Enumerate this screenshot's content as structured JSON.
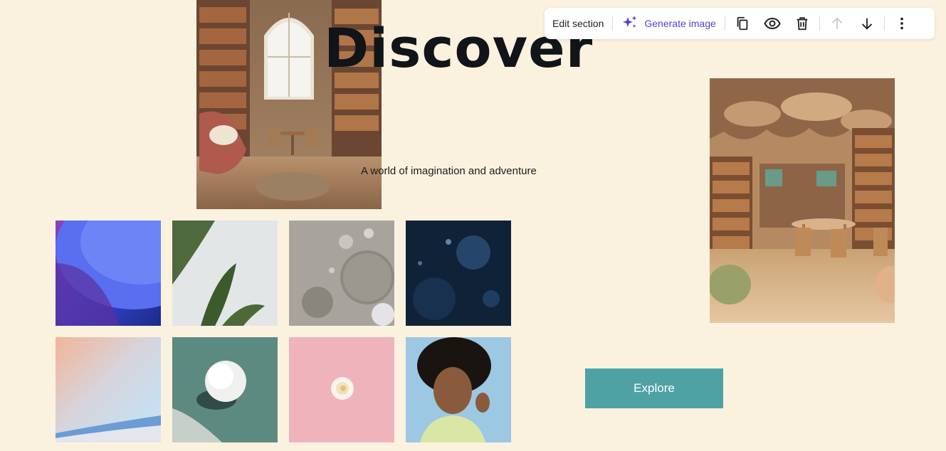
{
  "toolbar": {
    "edit_section_label": "Edit section",
    "generate_image_label": "Generate image",
    "accent_color": "#5b3ec9",
    "icons": [
      "sparkle-icon",
      "copy-icon",
      "eye-icon",
      "trash-icon",
      "arrow-up-icon",
      "arrow-down-icon",
      "more-vertical-icon"
    ]
  },
  "hero": {
    "title": "Discover",
    "subtitle": "A world of imagination and adventure",
    "button_label": "Explore",
    "button_color": "#4fa2a3",
    "background_color": "#faf2df"
  },
  "images": {
    "left_feature": "cozy-reading-room",
    "right_feature": "childrens-library",
    "grid": [
      "blue-abstract-curves",
      "green-leaves",
      "grey-bubbles",
      "dark-blue-bubbles",
      "pastel-gradient",
      "white-ball-on-green",
      "flower-on-pink",
      "smiling-woman"
    ]
  }
}
